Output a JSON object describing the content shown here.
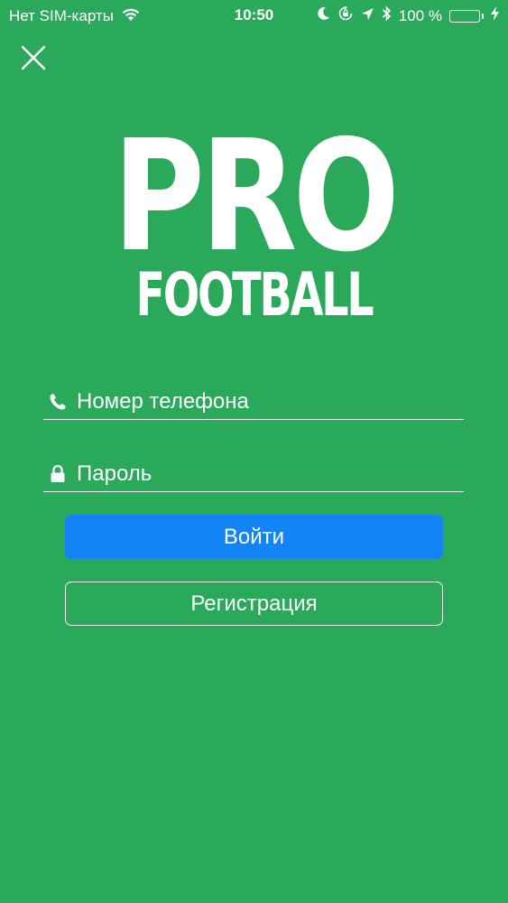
{
  "status_bar": {
    "carrier": "Нет SIM-карты",
    "time": "10:50",
    "battery_percent": "100 %",
    "battery_level": 1.0,
    "icons": [
      "wifi-icon",
      "moon-icon",
      "orientation-lock-icon",
      "location-icon",
      "bluetooth-icon",
      "battery-icon",
      "charging-icon"
    ]
  },
  "nav": {
    "close_icon": "close-icon"
  },
  "logo": {
    "line1": "PRO",
    "line2": "FOOTBALL"
  },
  "form": {
    "phone": {
      "placeholder": "Номер телефона",
      "value": "",
      "icon": "phone-icon"
    },
    "password": {
      "placeholder": "Пароль",
      "value": "",
      "icon": "lock-icon"
    },
    "login_label": "Войти",
    "register_label": "Регистрация"
  },
  "colors": {
    "background": "#2ba95a",
    "primary_button": "#1284f5",
    "text": "#ffffff"
  }
}
